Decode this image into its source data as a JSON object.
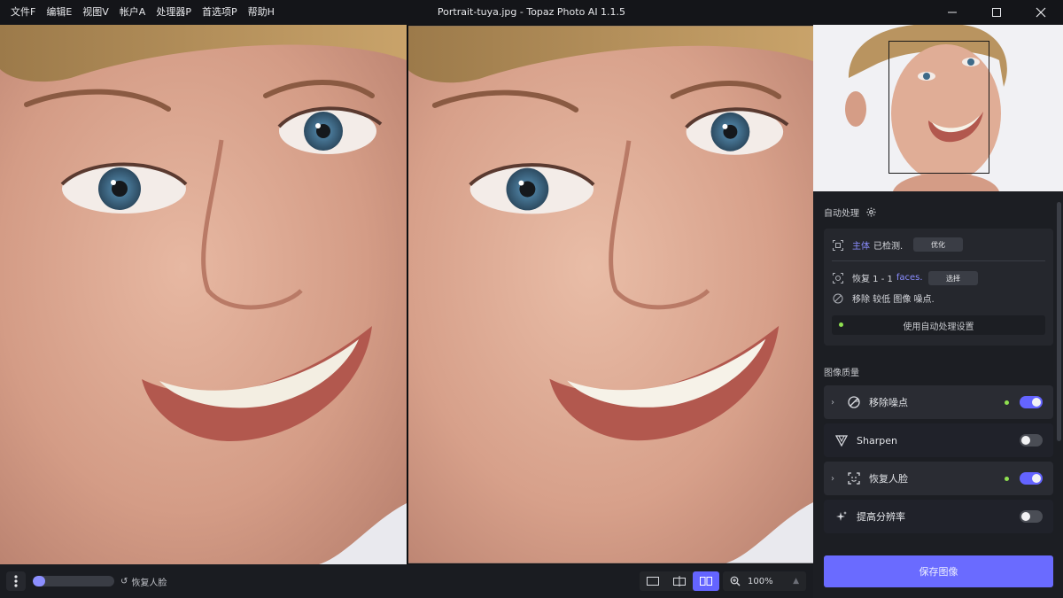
{
  "menu": [
    "文件F",
    "编辑E",
    "视图V",
    "帐户A",
    "处理器P",
    "首选项P",
    "帮助H"
  ],
  "window": {
    "title": "Portrait-tuya.jpg - Topaz Photo AI 1.1.5",
    "minimize_icon": "minimize-icon",
    "maximize_icon": "maximize-icon",
    "close_icon": "close-icon"
  },
  "bottom": {
    "progress_fraction": 0.15,
    "progress_label": "恢复人脸",
    "zoom": "100%"
  },
  "panel": {
    "auto_heading": "自动处理",
    "auto": {
      "subject_word": "主体",
      "subject_rest": "已检测.",
      "optimize_btn": "优化",
      "restore_prefix": "恢复 1 - 1",
      "restore_word": "faces.",
      "select_btn": "选择",
      "remove_line": "移除 较低 图像 噪点.",
      "use_settings": "使用自动处理设置"
    },
    "quality_heading": "图像质量",
    "filters": [
      {
        "label": "移除噪点",
        "enabled": true,
        "expandable": true,
        "icon": "denoise-icon"
      },
      {
        "label": "Sharpen",
        "enabled": false,
        "expandable": false,
        "icon": "sharpen-icon"
      },
      {
        "label": "恢复人脸",
        "enabled": true,
        "expandable": true,
        "icon": "face-recovery-icon"
      },
      {
        "label": "提高分辨率",
        "enabled": false,
        "expandable": false,
        "icon": "upscale-icon"
      }
    ],
    "save_button": "保存图像"
  },
  "colors": {
    "accent": "#6a6bff",
    "status_dot": "#8fe050",
    "panel_bg": "#1c1e23"
  }
}
